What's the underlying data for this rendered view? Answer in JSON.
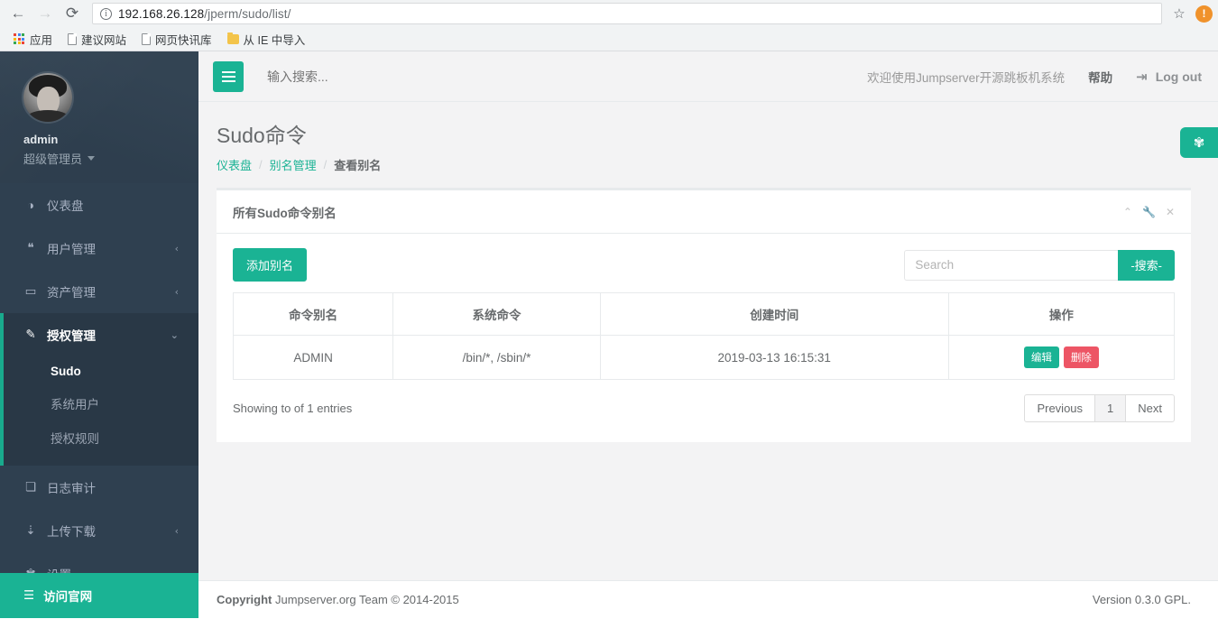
{
  "browser": {
    "back_icon": "←",
    "forward_icon": "→",
    "reload_icon": "⟳",
    "url_host": "192.168.26.128",
    "url_path": "/jperm/sudo/list/",
    "star_icon": "☆",
    "badge_label": "!",
    "bookmarks": [
      {
        "label": "应用",
        "icon": "apps-grid-icon"
      },
      {
        "label": "建议网站",
        "icon": "page-icon"
      },
      {
        "label": "网页快讯库",
        "icon": "page-icon"
      },
      {
        "label": "从 IE 中导入",
        "icon": "folder-icon"
      }
    ]
  },
  "sidebar": {
    "username": "admin",
    "role": "超级管理员",
    "items": [
      {
        "label": "仪表盘",
        "icon": "dashboard-icon",
        "glyph": "◑",
        "arrow": ""
      },
      {
        "label": "用户管理",
        "icon": "users-icon",
        "glyph": "❝",
        "arrow": "‹"
      },
      {
        "label": "资产管理",
        "icon": "asset-icon",
        "glyph": "▭",
        "arrow": "‹"
      },
      {
        "label": "授权管理",
        "icon": "edit-icon",
        "glyph": "✎",
        "arrow": "⌄"
      },
      {
        "label": "日志审计",
        "icon": "audit-icon",
        "glyph": "❏",
        "arrow": ""
      },
      {
        "label": "上传下载",
        "icon": "download-icon",
        "glyph": "⇣",
        "arrow": "‹"
      },
      {
        "label": "设置",
        "icon": "gears-icon",
        "glyph": "✾",
        "arrow": ""
      }
    ],
    "submenu": [
      {
        "label": "Sudo"
      },
      {
        "label": "系统用户"
      },
      {
        "label": "授权规则"
      }
    ],
    "footer": {
      "label": "访问官网",
      "glyph": "☰"
    }
  },
  "topnav": {
    "search_placeholder": "输入搜索...",
    "welcome": "欢迎使用Jumpserver开源跳板机系统",
    "help": "帮助",
    "logout": "Log out",
    "logout_icon": "⇥"
  },
  "page": {
    "title": "Sudo命令",
    "breadcrumb": [
      {
        "label": "仪表盘",
        "current": false
      },
      {
        "label": "别名管理",
        "current": false
      },
      {
        "label": "查看别名",
        "current": true
      }
    ],
    "breadcrumb_sep": "/"
  },
  "panel": {
    "title": "所有Sudo命令别名",
    "tools": {
      "collapse_icon": "⌃",
      "wrench_icon": "🔧",
      "close_icon": "✕"
    },
    "add_button": "添加别名",
    "search_placeholder": "Search",
    "search_button": "-搜索-",
    "table": {
      "headers": [
        "命令别名",
        "系统命令",
        "创建时间",
        "操作"
      ],
      "rows": [
        {
          "alias": "ADMIN",
          "command": "/bin/*, /sbin/*",
          "created": "2019-03-13 16:15:31",
          "edit_label": "编辑",
          "delete_label": "删除"
        }
      ]
    },
    "info": "Showing to of 1 entries",
    "pagination": {
      "previous": "Previous",
      "pages": [
        "1"
      ],
      "next": "Next"
    }
  },
  "footer": {
    "copyright_strong": "Copyright",
    "copyright_rest": "Jumpserver.org Team © 2014-2015",
    "version": "Version 0.3.0 GPL."
  },
  "float_button": {
    "icon": "gears-icon",
    "glyph": "✾"
  },
  "colors": {
    "accent": "#1ab394",
    "sidebar": "#2f4050",
    "sidebar_active": "#293846",
    "danger": "#ed5565",
    "text": "#676a6c"
  }
}
